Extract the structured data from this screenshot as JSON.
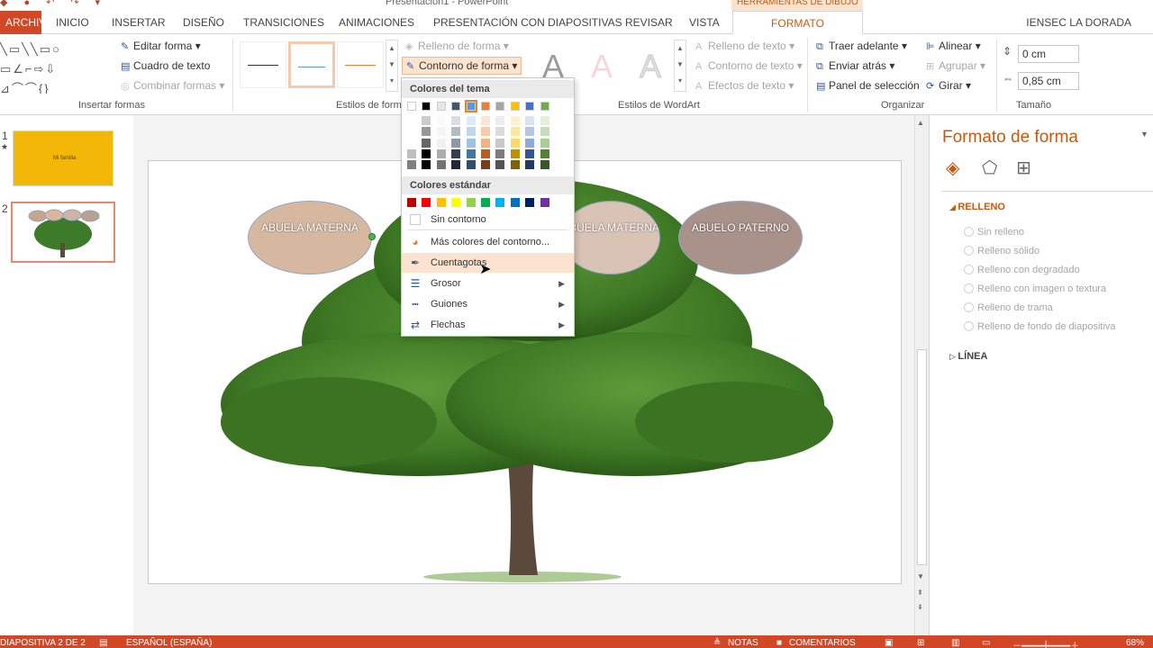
{
  "window": {
    "title": "Presentación1 - PowerPoint",
    "contextual_group": "HERRAMIENTAS DE DIBUJO",
    "user": "IENSEC LA DORADA"
  },
  "tabs": [
    {
      "label": "ARCHIVO"
    },
    {
      "label": "INICIO"
    },
    {
      "label": "INSERTAR"
    },
    {
      "label": "DISEÑO"
    },
    {
      "label": "TRANSICIONES"
    },
    {
      "label": "ANIMACIONES"
    },
    {
      "label": "PRESENTACIÓN CON DIAPOSITIVAS"
    },
    {
      "label": "REVISAR"
    },
    {
      "label": "VISTA"
    },
    {
      "label": "FORMATO"
    }
  ],
  "ribbon": {
    "insert_shapes": {
      "group_label": "Insertar formas",
      "edit_shape": "Editar forma",
      "text_box": "Cuadro de texto",
      "merge_shapes": "Combinar formas"
    },
    "shape_styles": {
      "group_label": "Estilos de form",
      "fill": "Relleno de forma",
      "outline": "Contorno de forma"
    },
    "wordart": {
      "group_label": "Estilos de WordArt",
      "text_fill": "Relleno de texto",
      "text_outline": "Contorno de texto",
      "text_effects": "Efectos de texto",
      "letter": "A"
    },
    "arrange": {
      "group_label": "Organizar",
      "bring_forward": "Traer adelante",
      "send_backward": "Enviar atrás",
      "selection_pane": "Panel de selección",
      "align": "Alinear",
      "group": "Agrupar",
      "rotate": "Girar"
    },
    "size": {
      "group_label": "Tamaño",
      "height": "0 cm",
      "width": "0,85 cm"
    }
  },
  "dropdown": {
    "theme_colors_header": "Colores del tema",
    "standard_colors_header": "Colores estándar",
    "theme_colors": [
      "#ffffff",
      "#000000",
      "#e7e6e6",
      "#44546a",
      "#5b9bd5",
      "#ed7d31",
      "#a5a5a5",
      "#ffc000",
      "#4472c4",
      "#70ad47"
    ],
    "standard_colors": [
      "#c00000",
      "#ff0000",
      "#ffc000",
      "#ffff00",
      "#92d050",
      "#00b050",
      "#00b0f0",
      "#0070c0",
      "#002060",
      "#7030a0"
    ],
    "items": [
      {
        "label": "Sin contorno"
      },
      {
        "label": "Más colores del contorno..."
      },
      {
        "label": "Cuentagotas"
      },
      {
        "label": "Grosor"
      },
      {
        "label": "Guiones"
      },
      {
        "label": "Flechas"
      }
    ]
  },
  "slides": {
    "slide1_number": "1",
    "slide1_text": "Mi familia",
    "slide2_number": "2"
  },
  "slide": {
    "oval1_label": "ABUELA MATERNA",
    "oval2_label": "ABUELA MATERNA",
    "oval3_label": "ABUELO PATERNO"
  },
  "format_pane": {
    "title": "Formato de forma",
    "fill_section": "RELLENO",
    "fill_options": [
      "Sin relleno",
      "Relleno sólido",
      "Relleno con degradado",
      "Relleno con imagen o textura",
      "Relleno de trama",
      "Relleno de fondo de diapositiva"
    ],
    "line_section": "LÍNEA"
  },
  "status": {
    "slide_info": "DIAPOSITIVA 2 DE 2",
    "language": "ESPAÑOL (ESPAÑA)",
    "notes": "NOTAS",
    "comments": "COMENTARIOS",
    "zoom": "68%"
  },
  "colors": {
    "accent": "#d24726",
    "contextual": "#c55a11",
    "highlight": "#fbe3d0"
  }
}
